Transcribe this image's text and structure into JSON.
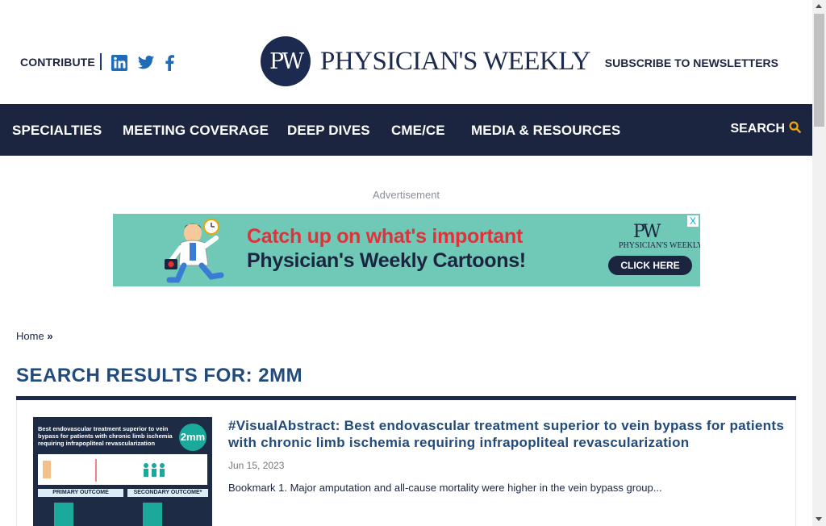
{
  "header": {
    "contribute_label": "CONTRIBUTE",
    "social_icons": [
      "linkedin-icon",
      "twitter-icon",
      "facebook-icon"
    ],
    "logo_mark": "PW",
    "logo_text": "PHYSICIAN'S WEEKLY",
    "subscribe_label": "SUBSCRIBE TO NEWSLETTERS"
  },
  "nav": {
    "items": [
      "SPECIALTIES",
      "MEETING COVERAGE",
      "DEEP DIVES",
      "CME/CE",
      "MEDIA & RESOURCES"
    ],
    "search_label": "SEARCH",
    "search_icon": "search-icon"
  },
  "ad": {
    "label": "Advertisement",
    "headline": "Catch up on what's important",
    "subline": "Physician's Weekly Cartoons!",
    "logo_mark": "PW",
    "logo_text": "PHYSICIAN'S WEEKLY",
    "cta": "CLICK HERE",
    "close": "X"
  },
  "breadcrumb": {
    "home": "Home",
    "separator": "»"
  },
  "results": {
    "title": "SEARCH RESULTS FOR: 2MM",
    "items": [
      {
        "title": "#VisualAbstract: Best endovascular treatment superior to vein bypass for patients with chronic limb ischemia requiring infrapopliteal revascularization",
        "date": "Jun 15, 2023",
        "excerpt": "Bookmark 1. Major amputation and all-cause mortality were higher in the vein bypass group...",
        "thumb": {
          "heading": "Best endovascular treatment superior to vein bypass for patients with chronic limb ischemia requiring infrapopliteal revascularization",
          "badge": "2mm",
          "primary": "PRIMARY OUTCOME",
          "secondary": "SECONDARY OUTCOME*"
        }
      }
    ]
  },
  "colors": {
    "nav_bg": "#1b2540",
    "title_blue": "#224a7a",
    "ad_bg": "#6fc9b6",
    "ad_red": "#e0323b",
    "search_accent": "#f0a500"
  }
}
